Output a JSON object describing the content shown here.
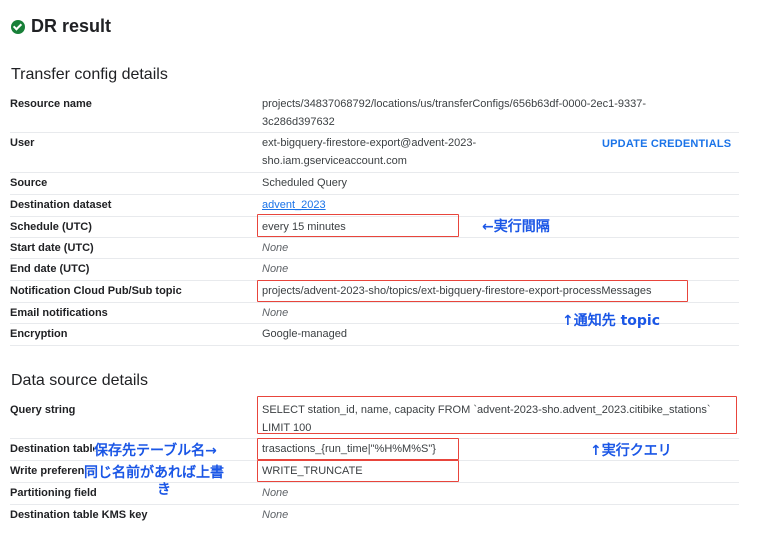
{
  "page_title": "DR result",
  "transfer_section": {
    "title": "Transfer config details",
    "rows": [
      {
        "label": "Resource name",
        "value": "projects/34837068792/locations/us/transferConfigs/656b63df-0000-2ec1-9337-",
        "value2": "3c286d397632"
      },
      {
        "label": "User",
        "value": "ext-bigquery-firestore-export@advent-2023-",
        "value2": "sho.iam.gserviceaccount.com"
      },
      {
        "label": "Source",
        "value": "Scheduled Query"
      },
      {
        "label": "Destination dataset",
        "value": "advent_2023"
      },
      {
        "label": "Schedule (UTC)",
        "value": "every 15 minutes"
      },
      {
        "label": "Start date (UTC)",
        "value": "None"
      },
      {
        "label": "End date (UTC)",
        "value": "None"
      },
      {
        "label": "Notification Cloud Pub/Sub topic",
        "value": "projects/advent-2023-sho/topics/ext-bigquery-firestore-export-processMessages"
      },
      {
        "label": "Email notifications",
        "value": "None"
      },
      {
        "label": "Encryption",
        "value": "Google-managed"
      }
    ],
    "update_credentials_label": "UPDATE CREDENTIALS"
  },
  "data_source_section": {
    "title": "Data source details",
    "rows": [
      {
        "label": "Query string",
        "value": "SELECT station_id, name, capacity FROM `advent-2023-sho.advent_2023.citibike_stations`",
        "value2": "LIMIT 100"
      },
      {
        "label": "Destination table",
        "value": "trasactions_{run_time|\"%H%M%S\"}"
      },
      {
        "label": "Write preference",
        "value": "WRITE_TRUNCATE"
      },
      {
        "label": "Partitioning field",
        "value": "None"
      },
      {
        "label": "Destination table KMS key",
        "value": "None"
      }
    ]
  },
  "annotations": {
    "interval": "←実行間隔",
    "notify_topic": "↑通知先 topic",
    "dest_table": "保存先テーブル名→",
    "overwrite_line1": "同じ名前があれば上書",
    "overwrite_line2": "き",
    "query": "↑実行クエリ"
  },
  "colors": {
    "accent": "#1a73e8",
    "success": "#188038",
    "highlight_box": "#e8453c",
    "annotation": "#1a56e6"
  },
  "icons": {
    "title": "check-circle-icon"
  }
}
